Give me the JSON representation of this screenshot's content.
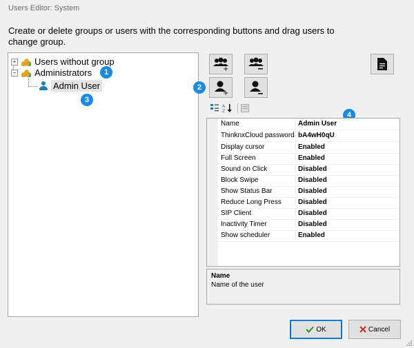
{
  "window": {
    "title": "Users Editor: System"
  },
  "instructions": "Create or delete groups or users with the corresponding buttons and drag users to change group.",
  "tree": {
    "groups": [
      {
        "label": "Users without group",
        "expander": "+"
      },
      {
        "label": "Administrators",
        "expander": "−"
      }
    ],
    "user": {
      "label": "Admin User"
    }
  },
  "badges": [
    "1",
    "2",
    "3",
    "4"
  ],
  "toolbar": {
    "buttons": [
      "add-group-icon",
      "remove-group-icon",
      "add-user-icon",
      "remove-user-icon",
      "document-icon"
    ]
  },
  "properties": [
    {
      "label": "Name",
      "value": "Admin User"
    },
    {
      "label": "ThinknxCloud password",
      "value": "bA4wH0qU"
    },
    {
      "label": "Display cursor",
      "value": "Enabled"
    },
    {
      "label": "Full Screen",
      "value": "Enabled"
    },
    {
      "label": "Sound on Click",
      "value": "Disabled"
    },
    {
      "label": "Block Swipe",
      "value": "Disabled"
    },
    {
      "label": "Show Status Bar",
      "value": "Disabled"
    },
    {
      "label": "Reduce Long Press",
      "value": "Disabled"
    },
    {
      "label": "SIP Client",
      "value": "Disabled"
    },
    {
      "label": "Inactivity Timer",
      "value": "Disabled"
    },
    {
      "label": "Show scheduler",
      "value": "Enabled"
    }
  ],
  "description": {
    "title": "Name",
    "text": "Name of the user"
  },
  "buttons": {
    "ok": "OK",
    "cancel": "Cancel"
  },
  "colors": {
    "accent": "#1a8ae5",
    "group_icon": "#e8a21c",
    "user_icon": "#1a7fc1"
  }
}
